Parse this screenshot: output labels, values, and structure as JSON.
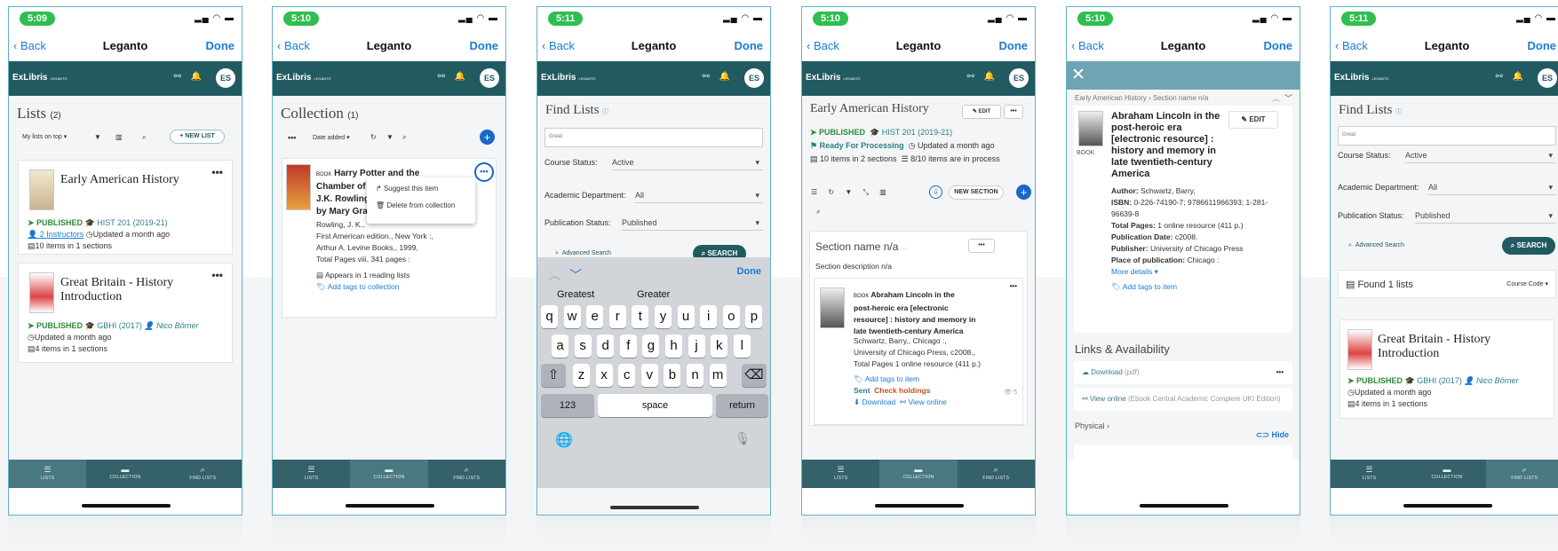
{
  "common": {
    "back": "Back",
    "app_title": "Leganto",
    "done": "Done",
    "logo": "ExLibris",
    "logo_sub": "LEGANTO",
    "avatar": "ES",
    "tabs": [
      "LISTS",
      "COLLECTION",
      "FIND LISTS"
    ]
  },
  "p1": {
    "time": "5:09",
    "heading": "Lists",
    "count": "(2)",
    "sort": "My lists on top",
    "new_list": "NEW LIST",
    "card1": {
      "title": "Early American History",
      "status": "PUBLISHED",
      "course": "HIST 201 (2019-21)",
      "instructors": "2 Instructors",
      "updated": "Updated a month ago",
      "items": "10 items in 1 sections"
    },
    "card2": {
      "title": "Great Britain - History Introduction",
      "status": "PUBLISHED",
      "course": "GBHI (2017)",
      "person": "Nico Börner",
      "updated": "Updated a month ago",
      "items": "4 items in 1 sections"
    }
  },
  "p2": {
    "time": "5:10",
    "heading": "Collection",
    "count": "(1)",
    "sort": "Date added",
    "item": {
      "type": "BOOK",
      "title1": "Harry Potter and the",
      "title2": "Chamber of S",
      "title3": "J.K. Rowling",
      "title4": "by Mary Gran",
      "line1": "Rowling, J. K.,",
      "line2": "First American edition., New York :,",
      "line3": "Arthur A. Levine Books,, 1999,",
      "line4": "Total Pages viii, 341 pages :",
      "reading": "Appears in 1 reading lists",
      "tags": "Add tags to collection"
    },
    "menu": [
      "Suggest this item",
      "Delete from collection"
    ]
  },
  "p3": {
    "time": "5:11",
    "heading": "Find Lists",
    "input": "Great",
    "course_status_label": "Course Status:",
    "course_status": "Active",
    "dept_label": "Academic Department:",
    "dept": "All",
    "pub_label": "Publication Status:",
    "pub": "Published",
    "advanced": "Advanced Search",
    "search": "SEARCH",
    "kb_done": "Done",
    "suggestions": [
      "Greatest",
      "Greater"
    ],
    "rows": [
      [
        "q",
        "w",
        "e",
        "r",
        "t",
        "y",
        "u",
        "i",
        "o",
        "p"
      ],
      [
        "a",
        "s",
        "d",
        "f",
        "g",
        "h",
        "j",
        "k",
        "l"
      ],
      [
        "z",
        "x",
        "c",
        "v",
        "b",
        "n",
        "m"
      ]
    ],
    "k123": "123",
    "space": "space",
    "return": "return"
  },
  "p4": {
    "time": "5:10",
    "heading": "Early American History",
    "edit": "EDIT",
    "status": "PUBLISHED",
    "course": "HIST 201 (2019-21)",
    "ready": "Ready For Processing",
    "updated": "Updated a month ago",
    "items": "10 items in 2 sections",
    "process": "8/10 items are in process",
    "new_section": "NEW SECTION",
    "section": "Section name n/a",
    "section_desc": "Section description n/a",
    "item": {
      "type": "BOOK",
      "t1": "Abraham Lincoln in the",
      "t2": "post-heroic era [electronic",
      "t3": "resource] : history and memory in",
      "t4": "late twentieth-century America",
      "l1": "Schwartz, Barry,, Chicago :,",
      "l2": "University of Chicago Press, c2008.,",
      "l3": "Total Pages 1 online resource (411 p.)",
      "tags": "Add tags to item",
      "sent": "Sent",
      "holdings": "Check holdings",
      "download": "Download",
      "view": "View online",
      "count": "5"
    }
  },
  "p5": {
    "time": "5:10",
    "crumb": "Early American History › Section name n/a",
    "type": "BOOK",
    "edit": "EDIT",
    "title": [
      "Abraham Lincoln in the",
      "post-heroic era",
      "[electronic resource] :",
      "history and memory in",
      "late twentieth-century",
      "America"
    ],
    "author_l": "Author:",
    "author": "Schwartz, Barry,",
    "isbn_l": "ISBN:",
    "isbn": "0-226-74190-7; 9786611966393; 1-281-96639-8",
    "pages_l": "Total Pages:",
    "pages": "1 online resource (411 p.)",
    "date_l": "Publication Date:",
    "date": "c2008.",
    "pub_l": "Publisher:",
    "pub": "University of Chicago Press",
    "place_l": "Place of publication:",
    "place": "Chicago :",
    "more": "More details",
    "tags": "Add tags to item",
    "links": "Links & Availability",
    "download": "Download",
    "pdf": "(pdf)",
    "view": "View online",
    "view_src": "(Ebook Central Academic Complete UKI Edition)",
    "physical": "Physical",
    "hide": "Hide"
  },
  "p6": {
    "time": "5:11",
    "heading": "Find Lists",
    "input": "Great",
    "course_status_label": "Course Status:",
    "course_status": "Active",
    "dept_label": "Academic Department:",
    "dept": "All",
    "pub_label": "Publication Status:",
    "pub": "Published",
    "advanced": "Advanced Search",
    "search": "SEARCH",
    "found": "Found 1 lists",
    "sort": "Course Code",
    "card": {
      "title": "Great Britain - History Introduction",
      "status": "PUBLISHED",
      "course": "GBHI (2017)",
      "person": "Nico Börner",
      "updated": "Updated a month ago",
      "items": "4 items in 1 sections"
    }
  },
  "colors": {
    "header": "#225a61",
    "accent": "#1a7bd8",
    "green": "#2e8b3a",
    "status_pill": "#2fbe4f"
  }
}
